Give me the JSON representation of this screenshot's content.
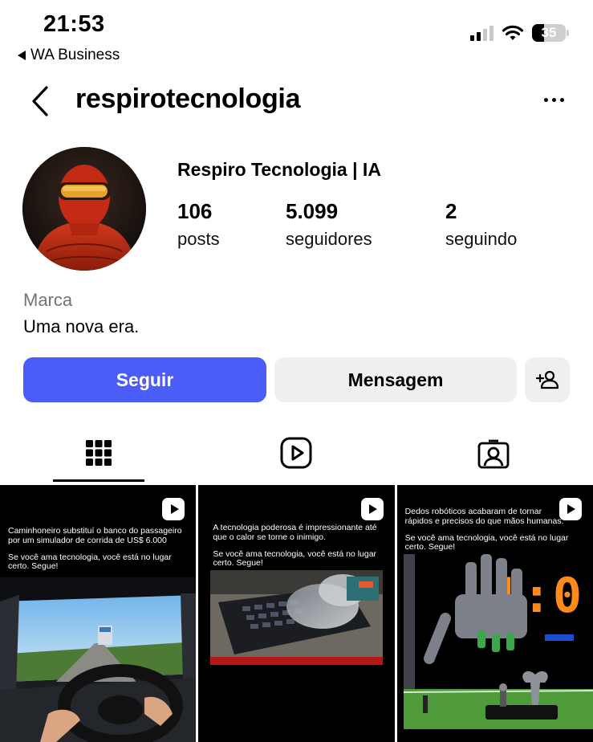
{
  "status_bar": {
    "time": "21:53",
    "back_app": "WA Business",
    "battery": "35"
  },
  "header": {
    "username": "respirotecnologia",
    "back_icon": "chevron-left-icon",
    "more_icon": "more-horizontal-icon"
  },
  "profile": {
    "display_name": "Respiro Tecnologia | IA",
    "stats": [
      {
        "number": "106",
        "label": "posts"
      },
      {
        "number": "5.099",
        "label": "seguidores"
      },
      {
        "number": "2",
        "label": "seguindo"
      }
    ],
    "category": "Marca",
    "bio": "Uma nova era."
  },
  "actions": {
    "follow_label": "Seguir",
    "message_label": "Mensagem",
    "follow_color": "#4a5df9"
  },
  "tabs": [
    {
      "icon": "grid-icon",
      "active": true
    },
    {
      "icon": "reels-icon",
      "active": false
    },
    {
      "icon": "tagged-icon",
      "active": false
    }
  ],
  "posts": [
    {
      "line1": "Caminhoneiro substituí o banco do passageiro por um simulador de corrida de US$ 6.000",
      "line2": "Se você ama tecnologia, você está no lugar certo. Segue!"
    },
    {
      "line1": "A tecnologia poderosa é impressionante até que o calor se torne o inimigo.",
      "line2": "Se você ama tecnologia, você está no lugar certo. Segue!"
    },
    {
      "line1": "Dedos robóticos acabaram de tornar rápidos e precisos do que mãos humanas.",
      "line2": "Se você ama tecnologia, você está no lugar certo. Segue!",
      "score": "1:0"
    }
  ]
}
